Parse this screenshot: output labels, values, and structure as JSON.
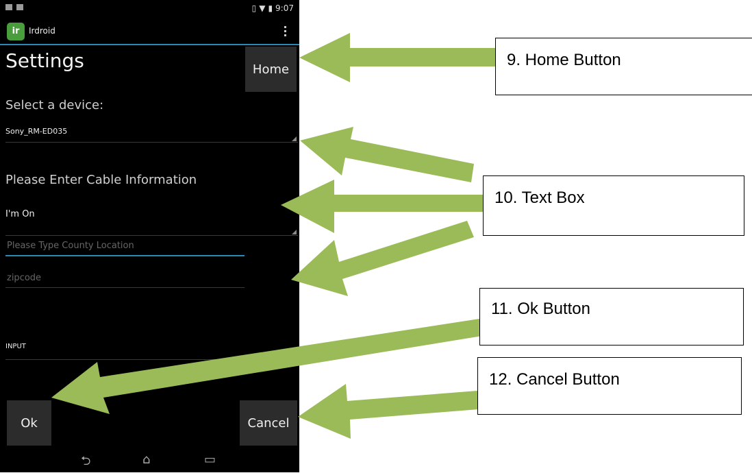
{
  "status_bar": {
    "time": "9:07"
  },
  "app": {
    "title": "Irdroid",
    "icon_text": "ir"
  },
  "settings": {
    "title": "Settings",
    "home_label": "Home",
    "select_label": "Select a device:",
    "device_value": "Sony_RM-ED035",
    "cable_label": "Please Enter Cable Information",
    "provider_value": "I'm On",
    "county_placeholder": "Please Type County Location",
    "zip_placeholder": "zipcode",
    "input_label": "INPUT",
    "ok_label": "Ok",
    "cancel_label": "Cancel"
  },
  "annotations": {
    "home": "9. Home Button",
    "text_box": "10. Text Box",
    "ok": "11. Ok Button",
    "cancel": "12. Cancel Button"
  },
  "colors": {
    "arrow": "#9bbb59",
    "accent": "#2b89b6"
  },
  "icons": [
    "battery-icon",
    "wifi-icon",
    "overflow-menu-icon",
    "back-icon",
    "home-nav-icon",
    "recents-icon"
  ]
}
